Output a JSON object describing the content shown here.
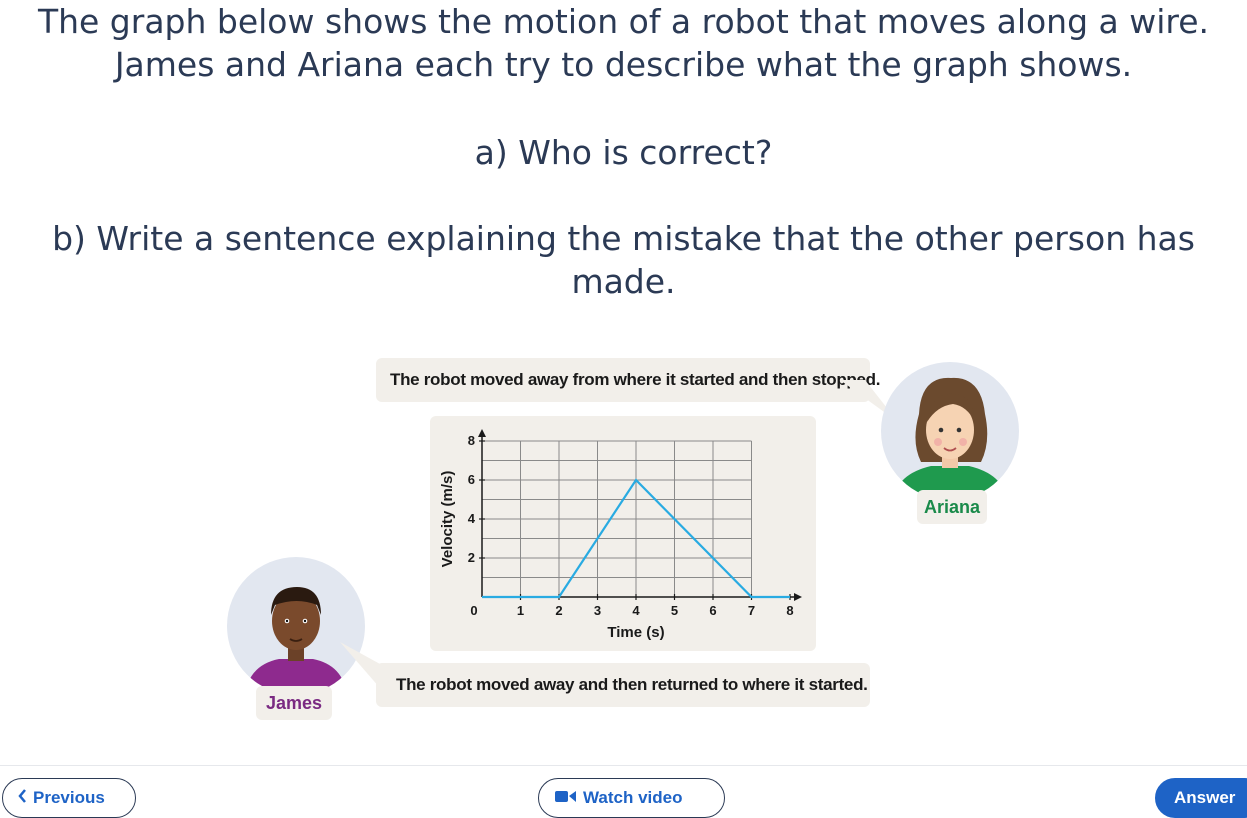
{
  "question": {
    "line1": "The graph below shows the motion of a robot that moves along a wire.",
    "line2": "James and Ariana each try to describe what the graph shows.",
    "part_a": "a) Who is correct?",
    "part_b_line1": "b) Write a sentence explaining the mistake that the other person has",
    "part_b_line2": "made."
  },
  "ariana": {
    "statement": "The robot moved away from where it started and then stopped.",
    "name": "Ariana"
  },
  "james": {
    "statement": "The robot moved away and then returned to where it started.",
    "name": "James"
  },
  "chart_data": {
    "type": "line",
    "xlabel": "Time (s)",
    "ylabel": "Velocity (m/s)",
    "x_ticks": [
      "0",
      "1",
      "2",
      "3",
      "4",
      "5",
      "6",
      "7",
      "8"
    ],
    "y_ticks": [
      "0",
      "2",
      "4",
      "6",
      "8"
    ],
    "xlim": [
      0,
      8
    ],
    "ylim": [
      0,
      8
    ],
    "grid": true,
    "series": [
      {
        "x": [
          0,
          2,
          4,
          7,
          8
        ],
        "y": [
          0,
          0,
          6,
          0,
          0
        ]
      }
    ],
    "line_color": "#29abe2"
  },
  "nav": {
    "previous_label": "Previous",
    "video_label": "Watch video",
    "answer_label": "Answer"
  },
  "colors": {
    "accent": "#1e63c6",
    "ariana_name": "#1a8a4a",
    "james_name": "#7a2a82",
    "panel": "#f2efea"
  }
}
